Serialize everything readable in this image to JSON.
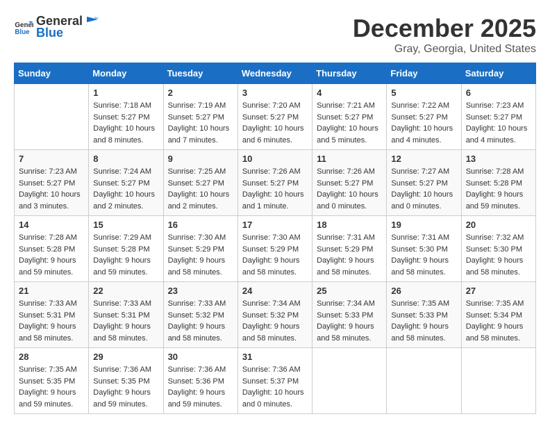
{
  "logo": {
    "text_general": "General",
    "text_blue": "Blue"
  },
  "title": {
    "month": "December 2025",
    "location": "Gray, Georgia, United States"
  },
  "headers": [
    "Sunday",
    "Monday",
    "Tuesday",
    "Wednesday",
    "Thursday",
    "Friday",
    "Saturday"
  ],
  "weeks": [
    [
      {
        "day": "",
        "sunrise": "",
        "sunset": "",
        "daylight": ""
      },
      {
        "day": "1",
        "sunrise": "7:18 AM",
        "sunset": "5:27 PM",
        "daylight": "10 hours and 8 minutes."
      },
      {
        "day": "2",
        "sunrise": "7:19 AM",
        "sunset": "5:27 PM",
        "daylight": "10 hours and 7 minutes."
      },
      {
        "day": "3",
        "sunrise": "7:20 AM",
        "sunset": "5:27 PM",
        "daylight": "10 hours and 6 minutes."
      },
      {
        "day": "4",
        "sunrise": "7:21 AM",
        "sunset": "5:27 PM",
        "daylight": "10 hours and 5 minutes."
      },
      {
        "day": "5",
        "sunrise": "7:22 AM",
        "sunset": "5:27 PM",
        "daylight": "10 hours and 4 minutes."
      },
      {
        "day": "6",
        "sunrise": "7:23 AM",
        "sunset": "5:27 PM",
        "daylight": "10 hours and 4 minutes."
      }
    ],
    [
      {
        "day": "7",
        "sunrise": "7:23 AM",
        "sunset": "5:27 PM",
        "daylight": "10 hours and 3 minutes."
      },
      {
        "day": "8",
        "sunrise": "7:24 AM",
        "sunset": "5:27 PM",
        "daylight": "10 hours and 2 minutes."
      },
      {
        "day": "9",
        "sunrise": "7:25 AM",
        "sunset": "5:27 PM",
        "daylight": "10 hours and 2 minutes."
      },
      {
        "day": "10",
        "sunrise": "7:26 AM",
        "sunset": "5:27 PM",
        "daylight": "10 hours and 1 minute."
      },
      {
        "day": "11",
        "sunrise": "7:26 AM",
        "sunset": "5:27 PM",
        "daylight": "10 hours and 0 minutes."
      },
      {
        "day": "12",
        "sunrise": "7:27 AM",
        "sunset": "5:27 PM",
        "daylight": "10 hours and 0 minutes."
      },
      {
        "day": "13",
        "sunrise": "7:28 AM",
        "sunset": "5:28 PM",
        "daylight": "9 hours and 59 minutes."
      }
    ],
    [
      {
        "day": "14",
        "sunrise": "7:28 AM",
        "sunset": "5:28 PM",
        "daylight": "9 hours and 59 minutes."
      },
      {
        "day": "15",
        "sunrise": "7:29 AM",
        "sunset": "5:28 PM",
        "daylight": "9 hours and 59 minutes."
      },
      {
        "day": "16",
        "sunrise": "7:30 AM",
        "sunset": "5:29 PM",
        "daylight": "9 hours and 58 minutes."
      },
      {
        "day": "17",
        "sunrise": "7:30 AM",
        "sunset": "5:29 PM",
        "daylight": "9 hours and 58 minutes."
      },
      {
        "day": "18",
        "sunrise": "7:31 AM",
        "sunset": "5:29 PM",
        "daylight": "9 hours and 58 minutes."
      },
      {
        "day": "19",
        "sunrise": "7:31 AM",
        "sunset": "5:30 PM",
        "daylight": "9 hours and 58 minutes."
      },
      {
        "day": "20",
        "sunrise": "7:32 AM",
        "sunset": "5:30 PM",
        "daylight": "9 hours and 58 minutes."
      }
    ],
    [
      {
        "day": "21",
        "sunrise": "7:33 AM",
        "sunset": "5:31 PM",
        "daylight": "9 hours and 58 minutes."
      },
      {
        "day": "22",
        "sunrise": "7:33 AM",
        "sunset": "5:31 PM",
        "daylight": "9 hours and 58 minutes."
      },
      {
        "day": "23",
        "sunrise": "7:33 AM",
        "sunset": "5:32 PM",
        "daylight": "9 hours and 58 minutes."
      },
      {
        "day": "24",
        "sunrise": "7:34 AM",
        "sunset": "5:32 PM",
        "daylight": "9 hours and 58 minutes."
      },
      {
        "day": "25",
        "sunrise": "7:34 AM",
        "sunset": "5:33 PM",
        "daylight": "9 hours and 58 minutes."
      },
      {
        "day": "26",
        "sunrise": "7:35 AM",
        "sunset": "5:33 PM",
        "daylight": "9 hours and 58 minutes."
      },
      {
        "day": "27",
        "sunrise": "7:35 AM",
        "sunset": "5:34 PM",
        "daylight": "9 hours and 58 minutes."
      }
    ],
    [
      {
        "day": "28",
        "sunrise": "7:35 AM",
        "sunset": "5:35 PM",
        "daylight": "9 hours and 59 minutes."
      },
      {
        "day": "29",
        "sunrise": "7:36 AM",
        "sunset": "5:35 PM",
        "daylight": "9 hours and 59 minutes."
      },
      {
        "day": "30",
        "sunrise": "7:36 AM",
        "sunset": "5:36 PM",
        "daylight": "9 hours and 59 minutes."
      },
      {
        "day": "31",
        "sunrise": "7:36 AM",
        "sunset": "5:37 PM",
        "daylight": "10 hours and 0 minutes."
      },
      {
        "day": "",
        "sunrise": "",
        "sunset": "",
        "daylight": ""
      },
      {
        "day": "",
        "sunrise": "",
        "sunset": "",
        "daylight": ""
      },
      {
        "day": "",
        "sunrise": "",
        "sunset": "",
        "daylight": ""
      }
    ]
  ],
  "cell_labels": {
    "sunrise": "Sunrise:",
    "sunset": "Sunset:",
    "daylight": "Daylight:"
  }
}
